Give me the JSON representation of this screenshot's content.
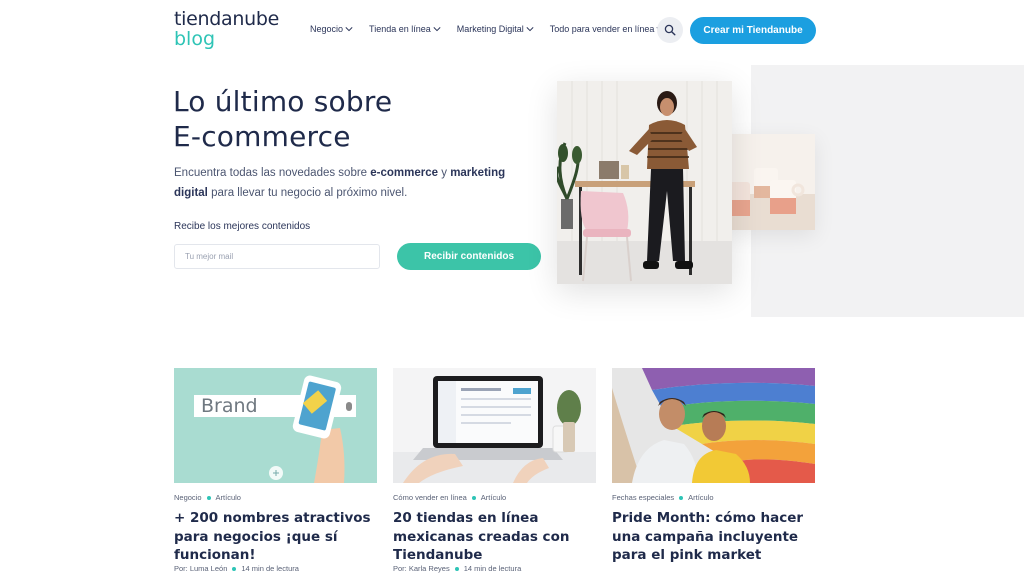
{
  "header": {
    "logo_top": "tiendanube",
    "logo_bottom": "blog",
    "nav": [
      {
        "label": "Negocio"
      },
      {
        "label": "Tienda en línea"
      },
      {
        "label": "Marketing Digital"
      },
      {
        "label": "Todo para vender en línea"
      }
    ],
    "search_icon": "search-icon",
    "cta_label": "Crear mi Tiendanube"
  },
  "hero": {
    "title_line1": "Lo último sobre",
    "title_line2": "E-commerce",
    "sub_part1": "Encuentra todas las novedades sobre ",
    "sub_bold1": "e-commerce",
    "sub_part2": " y ",
    "sub_bold2": "marketing digital",
    "sub_part3": " para llevar tu negocio al próximo nivel.",
    "form_label": "Recibe los mejores contenidos",
    "email_placeholder": "Tu mejor mail",
    "subscribe_label": "Recibir contenidos"
  },
  "cards": [
    {
      "category": "Negocio",
      "type": "Artículo",
      "title": "+ 200 nombres atractivos para negocios ¡que sí funcionan!",
      "author": "Por: Luma León",
      "read_time": "14 min de lectura",
      "image_text": "Brand"
    },
    {
      "category": "Cómo vender en línea",
      "type": "Artículo",
      "title": "20 tiendas en línea mexicanas creadas con Tiendanube",
      "author": "Por: Karla Reyes",
      "read_time": "14 min de lectura"
    },
    {
      "category": "Fechas especiales",
      "type": "Artículo",
      "title": "Pride Month: cómo hacer una campaña incluyente para el pink market",
      "author": "",
      "read_time": ""
    }
  ],
  "colors": {
    "brand_navy": "#1f2a4a",
    "brand_teal": "#2ec4b6",
    "cta_blue": "#1b9fe0",
    "subscribe_green": "#3cc4a8"
  }
}
